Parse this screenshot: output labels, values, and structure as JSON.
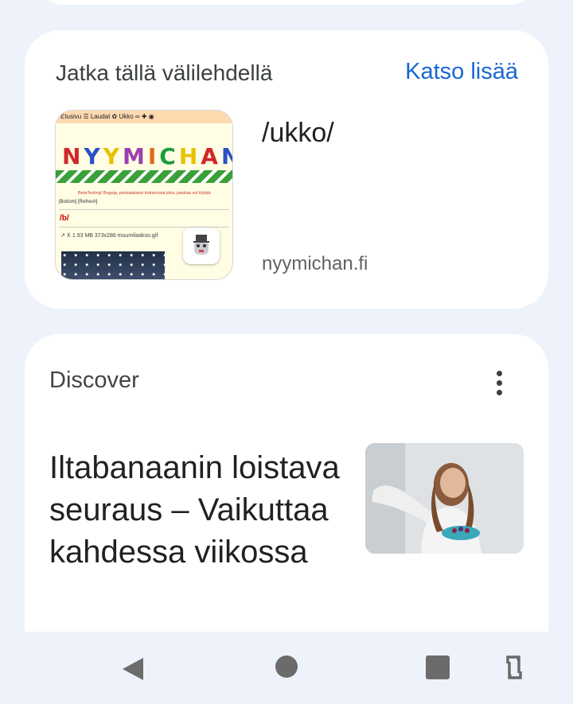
{
  "continue_card": {
    "title": "Jatka tällä välilehdellä",
    "see_more": "Katso lisää",
    "tab": {
      "page_title": "/ukko/",
      "domain": "nyymichan.fi",
      "thumbnail": {
        "topbar": "Etusivu ☰ Laudat ✿ Ukko ∞ ✚ ◉",
        "logo_letters": [
          "N",
          "Y",
          "Y",
          "M",
          "I",
          "C",
          "H",
          "A",
          "N"
        ],
        "logo_colors": [
          "#d12727",
          "#2a50c8",
          "#e6c200",
          "#9a3fb0",
          "#e06a1a",
          "#1a9c3e",
          "#e6c200",
          "#d12727",
          "#2a50c8"
        ],
        "notice": "BetaTesting! Bugeja, poistaaksesi kotisivusta joka, paskaa voi löytää",
        "links": "[Bottom] [Refresh]",
        "board": "/b/",
        "file_info": "1.93 MB 373x286 muumilaakso.gif"
      }
    }
  },
  "discover": {
    "title": "Discover",
    "headline": "Iltabanaanin loistava seuraus – Vaikuttaa kahdessa viikossa"
  },
  "navbar": {
    "icons": [
      "back-icon",
      "home-icon",
      "recents-icon",
      "rotate-icon"
    ]
  }
}
